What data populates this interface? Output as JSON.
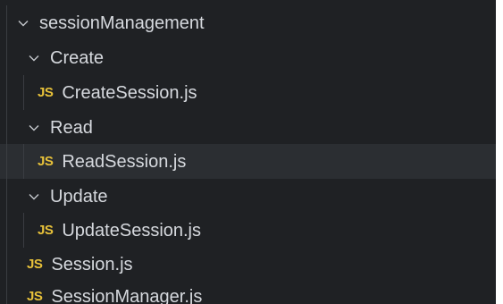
{
  "explorer": {
    "tree": [
      {
        "type": "folder",
        "name": "sessionManagement",
        "expanded": true,
        "icon": "chevron-down-icon"
      },
      {
        "type": "folder",
        "name": "Create",
        "expanded": true,
        "icon": "chevron-down-icon"
      },
      {
        "type": "file",
        "name": "CreateSession.js",
        "badge": "JS",
        "icon": "javascript-file-icon"
      },
      {
        "type": "folder",
        "name": "Read",
        "expanded": true,
        "icon": "chevron-down-icon"
      },
      {
        "type": "file",
        "name": "ReadSession.js",
        "badge": "JS",
        "selected": true,
        "icon": "javascript-file-icon"
      },
      {
        "type": "folder",
        "name": "Update",
        "expanded": true,
        "icon": "chevron-down-icon"
      },
      {
        "type": "file",
        "name": "UpdateSession.js",
        "badge": "JS",
        "icon": "javascript-file-icon"
      },
      {
        "type": "file",
        "name": "Session.js",
        "badge": "JS",
        "icon": "javascript-file-icon"
      },
      {
        "type": "file",
        "name": "SessionManager.js",
        "badge": "JS",
        "icon": "javascript-file-icon"
      }
    ]
  },
  "colors": {
    "background": "#1f2124",
    "selected_row": "#2b2e32",
    "text": "#d6d9de",
    "js_badge": "#e8c23a",
    "indent_guide": "#3a3d42"
  }
}
